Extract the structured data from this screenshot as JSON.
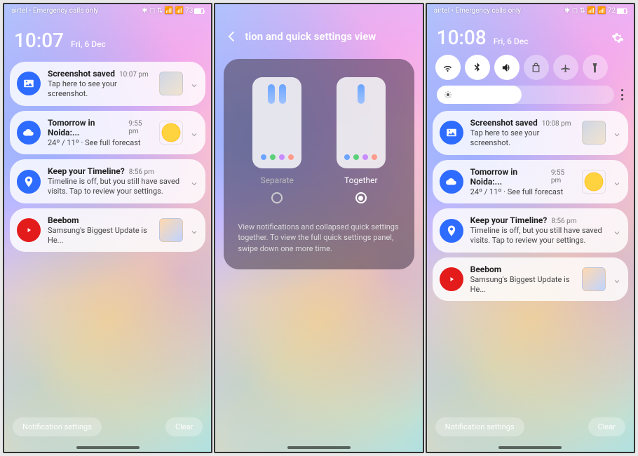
{
  "status_left": "airtel • Emergency calls only",
  "battery_pct": "73",
  "left": {
    "time": "10:07",
    "date": "Fri, 6 Dec"
  },
  "right": {
    "time": "10:08",
    "date": "Fri, 6 Dec"
  },
  "notifications": [
    {
      "id": "screenshot",
      "icon": "image",
      "icon_bg": "#2e6bff",
      "title": "Screenshot saved",
      "time_left": "10:07 pm",
      "time_right": "10:08 pm",
      "sub": "Tap here to see your screenshot.",
      "thumb": "file"
    },
    {
      "id": "weather",
      "icon": "cloud",
      "icon_bg": "#2e6bff",
      "title": "Tomorrow in Noida:...",
      "time": "9:55 pm",
      "sub": "24º / 11º · See full forecast",
      "thumb": "sun"
    },
    {
      "id": "timeline",
      "icon": "pin",
      "icon_bg": "#2e6bff",
      "title": "Keep your Timeline?",
      "time": "8:56 pm",
      "sub": "Timeline is off, but you still have saved visits. Tap to review your settings."
    },
    {
      "id": "youtube",
      "icon": "youtube",
      "icon_bg": "#e31b1b",
      "title": "Beebom",
      "sub": "Samsung's Biggest Update is He...",
      "thumb": "person"
    }
  ],
  "buttons": {
    "settings": "Notification settings",
    "clear": "Clear"
  },
  "center": {
    "header": "tion and quick settings view",
    "opt1": "Separate",
    "opt2": "Together",
    "desc": "View notifications and collapsed quick settings together. To view the full quick settings panel, swipe down one more time."
  },
  "qs": {
    "wifi_on": true,
    "bt_on": true,
    "sound_on": true,
    "rotate_on": false,
    "plane_on": false,
    "torch_on": false
  }
}
